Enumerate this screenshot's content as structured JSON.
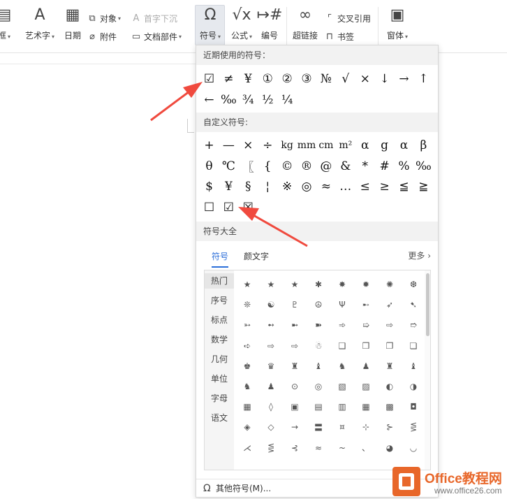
{
  "ribbon": {
    "textbox_label": "框",
    "arttext_label": "艺术字",
    "date_label": "日期",
    "object_label": "对象",
    "attachment_label": "附件",
    "dropcap_label": "首字下沉",
    "docpart_label": "文档部件",
    "symbol_label": "符号",
    "formula_label": "公式",
    "numbering_label": "编号",
    "crossref_label": "交叉引用",
    "hyperlink_label": "超链接",
    "bookmark_label": "书签",
    "window_label": "窗体"
  },
  "panel": {
    "recent_title": "近期使用的符号：",
    "recent_symbols": [
      "☑",
      "≠",
      "¥",
      "①",
      "②",
      "③",
      "№",
      "√",
      "×",
      "↓",
      "→",
      "↑",
      "←",
      "‰",
      "¾",
      "½",
      "¼"
    ],
    "custom_title": "自定义符号:",
    "custom_symbols": [
      "+",
      "—",
      "×",
      "÷",
      "kg",
      "mm",
      "cm",
      "m²",
      "α",
      "g",
      "α",
      "β",
      "θ",
      "℃",
      "〖",
      "{",
      "©",
      "®",
      "@",
      "&",
      "*",
      "#",
      "%",
      "‰",
      "$",
      "¥",
      "§",
      "¦",
      "※",
      "◎",
      "≈",
      "…",
      "≤",
      "≥",
      "≦",
      "≧",
      "☐",
      "☑",
      "☒"
    ],
    "all_title": "符号大全",
    "tabs": [
      "符号",
      "颜文字"
    ],
    "more_label": "更多",
    "categories": [
      "热门",
      "序号",
      "标点",
      "数学",
      "几何",
      "单位",
      "字母",
      "语文"
    ],
    "library_symbols": [
      "★",
      "★",
      "★",
      "✱",
      "✸",
      "✹",
      "✺",
      "❆",
      "❊",
      "☯",
      "♇",
      "☮",
      "Ψ",
      "➸",
      "➶",
      "➷",
      "➳",
      "➻",
      "➼",
      "➽",
      "➾",
      "➯",
      "⇨",
      "➱",
      "➪",
      "⇨",
      "⇨",
      "☃",
      "❑",
      "❒",
      "❐",
      "❏",
      "♚",
      "♛",
      "♜",
      "♝",
      "♞",
      "♟",
      "♜",
      "♝",
      "♞",
      "♟",
      "⊙",
      "◎",
      "▧",
      "▨",
      "◐",
      "◑",
      "▦",
      "◊",
      "▣",
      "▤",
      "▥",
      "▦",
      "▩",
      "◘",
      "◈",
      "◇",
      "→",
      "〓",
      "¤",
      "⊹",
      "⊱",
      "⋚",
      "⋌",
      "⋚",
      "⊰",
      "≈",
      "~",
      "、",
      "◕",
      "◡"
    ],
    "footer_label": "其他符号(M)..."
  },
  "watermark": {
    "brand": "Office教程网",
    "url": "www.office26.com"
  },
  "colors": {
    "accent_blue": "#2b6ed9",
    "arrow_red": "#f04a3e",
    "logo_orange": "#e8672a"
  }
}
